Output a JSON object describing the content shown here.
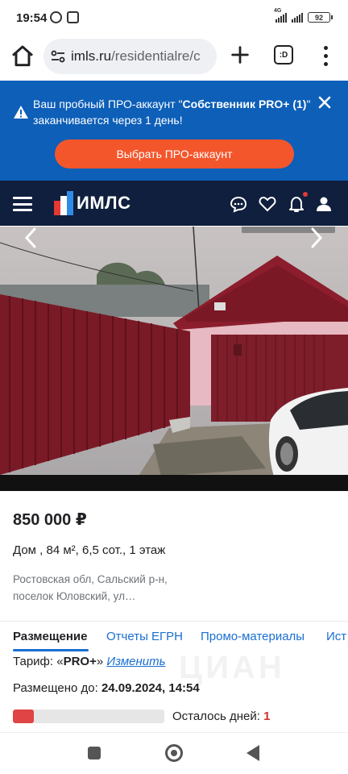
{
  "status_bar": {
    "time": "19:54",
    "network_label": "4G",
    "battery": "92"
  },
  "browser": {
    "url_host": "imls.ru",
    "url_path": "/residentialre/c",
    "tabs_label": ":D"
  },
  "promo": {
    "line_before": "Ваш пробный ПРО-аккаунт \"",
    "plan_name": "Собственник PRO+ (1)",
    "line_after": "\" заканчивается через 1 день!",
    "cta_label": "Выбрать ПРО-аккаунт",
    "bg_color": "#0d5fb8",
    "cta_color": "#f4562c"
  },
  "site_header": {
    "logo_text": "ИМЛС",
    "bg_color": "#0f1f3d"
  },
  "listing": {
    "price": "850 000 ₽",
    "description": "Дом , 84 м², 6,5 сот., 1 этаж",
    "address": "Ростовская обл, Сальский р-н, поселок Юловский, ул…"
  },
  "tabs": [
    {
      "label": "Размещение",
      "active": true
    },
    {
      "label": "Отчеты ЕГРН",
      "active": false
    },
    {
      "label": "Промо-материалы",
      "active": false
    },
    {
      "label": "Ист",
      "active": false
    }
  ],
  "tariff": {
    "label": "Тариф: «",
    "value": "PRO+",
    "close": "» ",
    "change_label": "Изменить"
  },
  "placement": {
    "label": "Размещено до: ",
    "date": "24.09.2024, 14:54"
  },
  "remaining": {
    "label": "Осталось дней: ",
    "days": "1",
    "progress_fraction": 0.14
  },
  "icons": {
    "home": "home-icon",
    "tune": "tune-icon",
    "add": "plus-icon",
    "menu": "more-vert-icon",
    "warning": "warning-icon",
    "close": "close-icon",
    "chat": "chat-icon",
    "favorite": "heart-icon",
    "bell": "bell-icon",
    "user": "user-icon",
    "prev": "chevron-left-icon",
    "next": "chevron-right-icon"
  }
}
